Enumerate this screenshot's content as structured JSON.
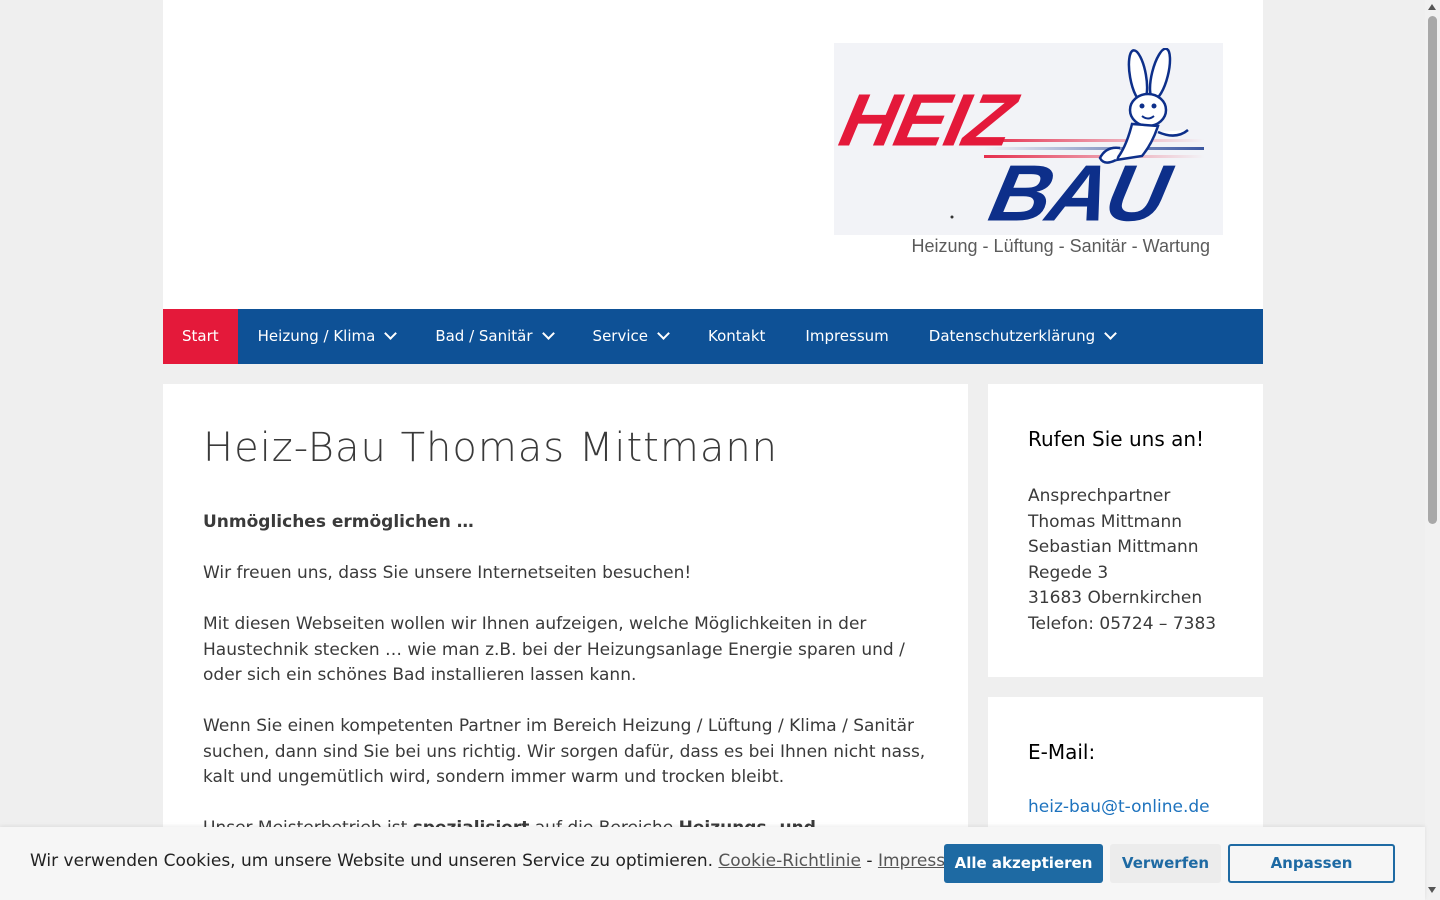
{
  "logo": {
    "heiz": "HEIZ",
    "bau": "BAU",
    "tagline": "Heizung - Lüftung - Sanitär - Wartung",
    "colors": {
      "red": "#e4193a",
      "blue": "#0d2f8a"
    }
  },
  "nav": {
    "items": [
      {
        "label": "Start",
        "active": true,
        "dropdown": false
      },
      {
        "label": "Heizung / Klima",
        "dropdown": true
      },
      {
        "label": "Bad / Sanitär",
        "dropdown": true
      },
      {
        "label": "Service",
        "dropdown": true
      },
      {
        "label": "Kontakt",
        "dropdown": false
      },
      {
        "label": "Impressum",
        "dropdown": false
      },
      {
        "label": "Datenschutzerklärung",
        "dropdown": true
      }
    ],
    "colors": {
      "background": "#0e5196",
      "active": "#e4193a"
    }
  },
  "main": {
    "title": "Heiz-Bau Thomas Mittmann",
    "lead": "Unmögliches ermöglichen …",
    "p1": "Wir freuen uns, dass Sie unsere Internetseiten besuchen!",
    "p2": "Mit diesen Webseiten wollen wir Ihnen aufzeigen, welche Möglichkeiten in der Haustechnik stecken … wie man z.B. bei der Heizungsanlage Energie sparen und / oder sich ein schönes Bad installieren lassen kann.",
    "p3": "Wenn Sie einen kompetenten Partner im Bereich Heizung / Lüftung / Klima / Sanitär suchen, dann sind Sie bei uns richtig. Wir sorgen dafür, dass es bei Ihnen nicht nass, kalt und ungemütlich wird, sondern immer warm und trocken bleibt.",
    "p4_start": "Unser Meisterbetrieb ist ",
    "p4_bold1": "spezialisiert",
    "p4_mid": " auf die Bereiche ",
    "p4_bold2": "Heizungs- und"
  },
  "sidebar": {
    "contact": {
      "title": "Rufen Sie uns an!",
      "lines": [
        "Ansprechpartner",
        "Thomas Mittmann",
        "Sebastian Mittmann",
        "Regede 3",
        "31683 Obernkirchen",
        "Telefon: 05724 – 7383"
      ]
    },
    "email": {
      "title": "E-Mail:",
      "address": "heiz-bau@t-online.de"
    }
  },
  "cookie": {
    "text": "Wir verwenden Cookies, um unsere Website und unseren Service zu optimieren.",
    "policy_link": "Cookie-Richtlinie",
    "separator": "-",
    "imprint_link": "Impressum",
    "accept": "Alle akzeptieren",
    "reject": "Verwerfen",
    "customize": "Anpassen",
    "accent": "#1e6aa3"
  }
}
